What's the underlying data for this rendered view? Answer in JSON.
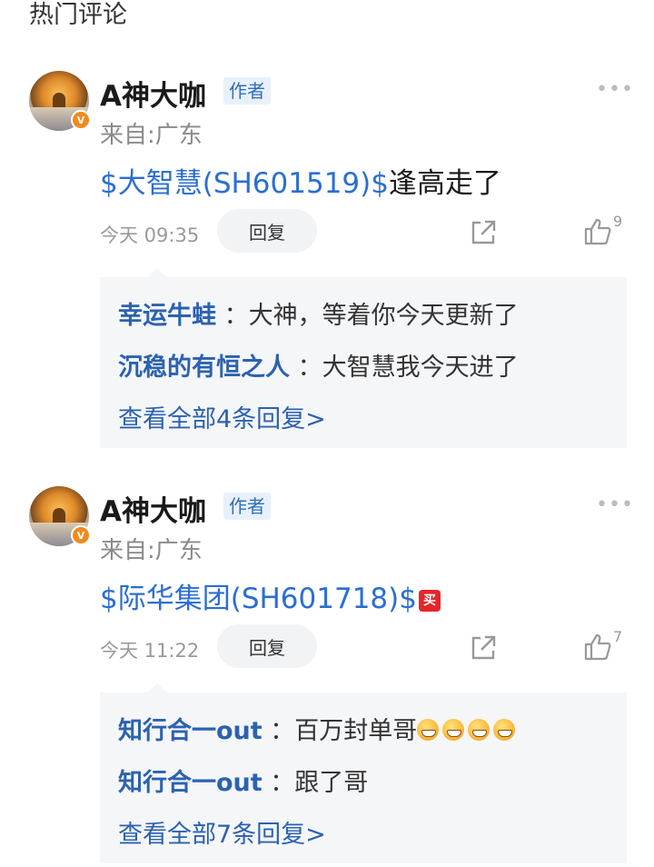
{
  "section_title": "热门评论",
  "comments": [
    {
      "author": "A神大咖",
      "tag": "作者",
      "location": "来自:广东",
      "stock": "$大智慧(SH601519)$",
      "text": "逢高走了",
      "time": "今天 09:35",
      "reply_label": "回复",
      "likes": "9",
      "replies": [
        {
          "user": "幸运牛蛙",
          "sep": "：",
          "text": "大神，等着你今天更新了"
        },
        {
          "user": "沉稳的有恒之人",
          "sep": "：",
          "text": "大智慧我今天进了"
        }
      ],
      "view_all": "查看全部4条回复>"
    },
    {
      "author": "A神大咖",
      "tag": "作者",
      "location": "来自:广东",
      "stock": "$际华集团(SH601718)$",
      "buy_badge": "买",
      "time": "今天 11:22",
      "reply_label": "回复",
      "likes": "7",
      "replies": [
        {
          "user": "知行合一out",
          "sep": "：",
          "text": "百万封单哥"
        },
        {
          "user": "知行合一out",
          "sep": "：",
          "text": "跟了哥"
        }
      ],
      "view_all": "查看全部7条回复>"
    }
  ],
  "icons": {
    "verified_badge": "V",
    "more": "•••",
    "emoji": "grinning-face-icon"
  },
  "colors": {
    "link_blue": "#2b6ed3",
    "reply_user_blue": "#2b62b0",
    "tag_bg": "#e8f1fb",
    "badge_orange": "#f28a1d",
    "buy_red": "#e4262b"
  }
}
